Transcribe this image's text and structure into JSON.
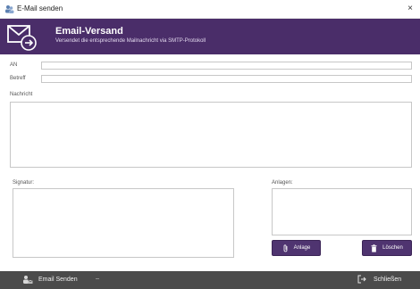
{
  "window": {
    "title": "E-Mail senden",
    "close_glyph": "×"
  },
  "header": {
    "title": "Email-Versand",
    "subtitle": "Versendet die entsprechende Mailnachricht via SMTP-Protokoll",
    "icon": "mail-send-icon",
    "bg_color": "#4a2d69"
  },
  "form": {
    "to_label": "AN",
    "to_value": "",
    "subject_label": "Betreff",
    "subject_value": "",
    "message_label": "Nachricht",
    "message_value": "",
    "signature_label": "Signatur:",
    "signature_value": "",
    "attachments_label": "Anlagen:"
  },
  "buttons": {
    "attach_label": "Anlage",
    "delete_label": "Löschen",
    "accent_color": "#4f3470"
  },
  "footer": {
    "send_label": "Email Senden",
    "close_label": "Schließen",
    "bg_color": "#4b4b4b"
  }
}
